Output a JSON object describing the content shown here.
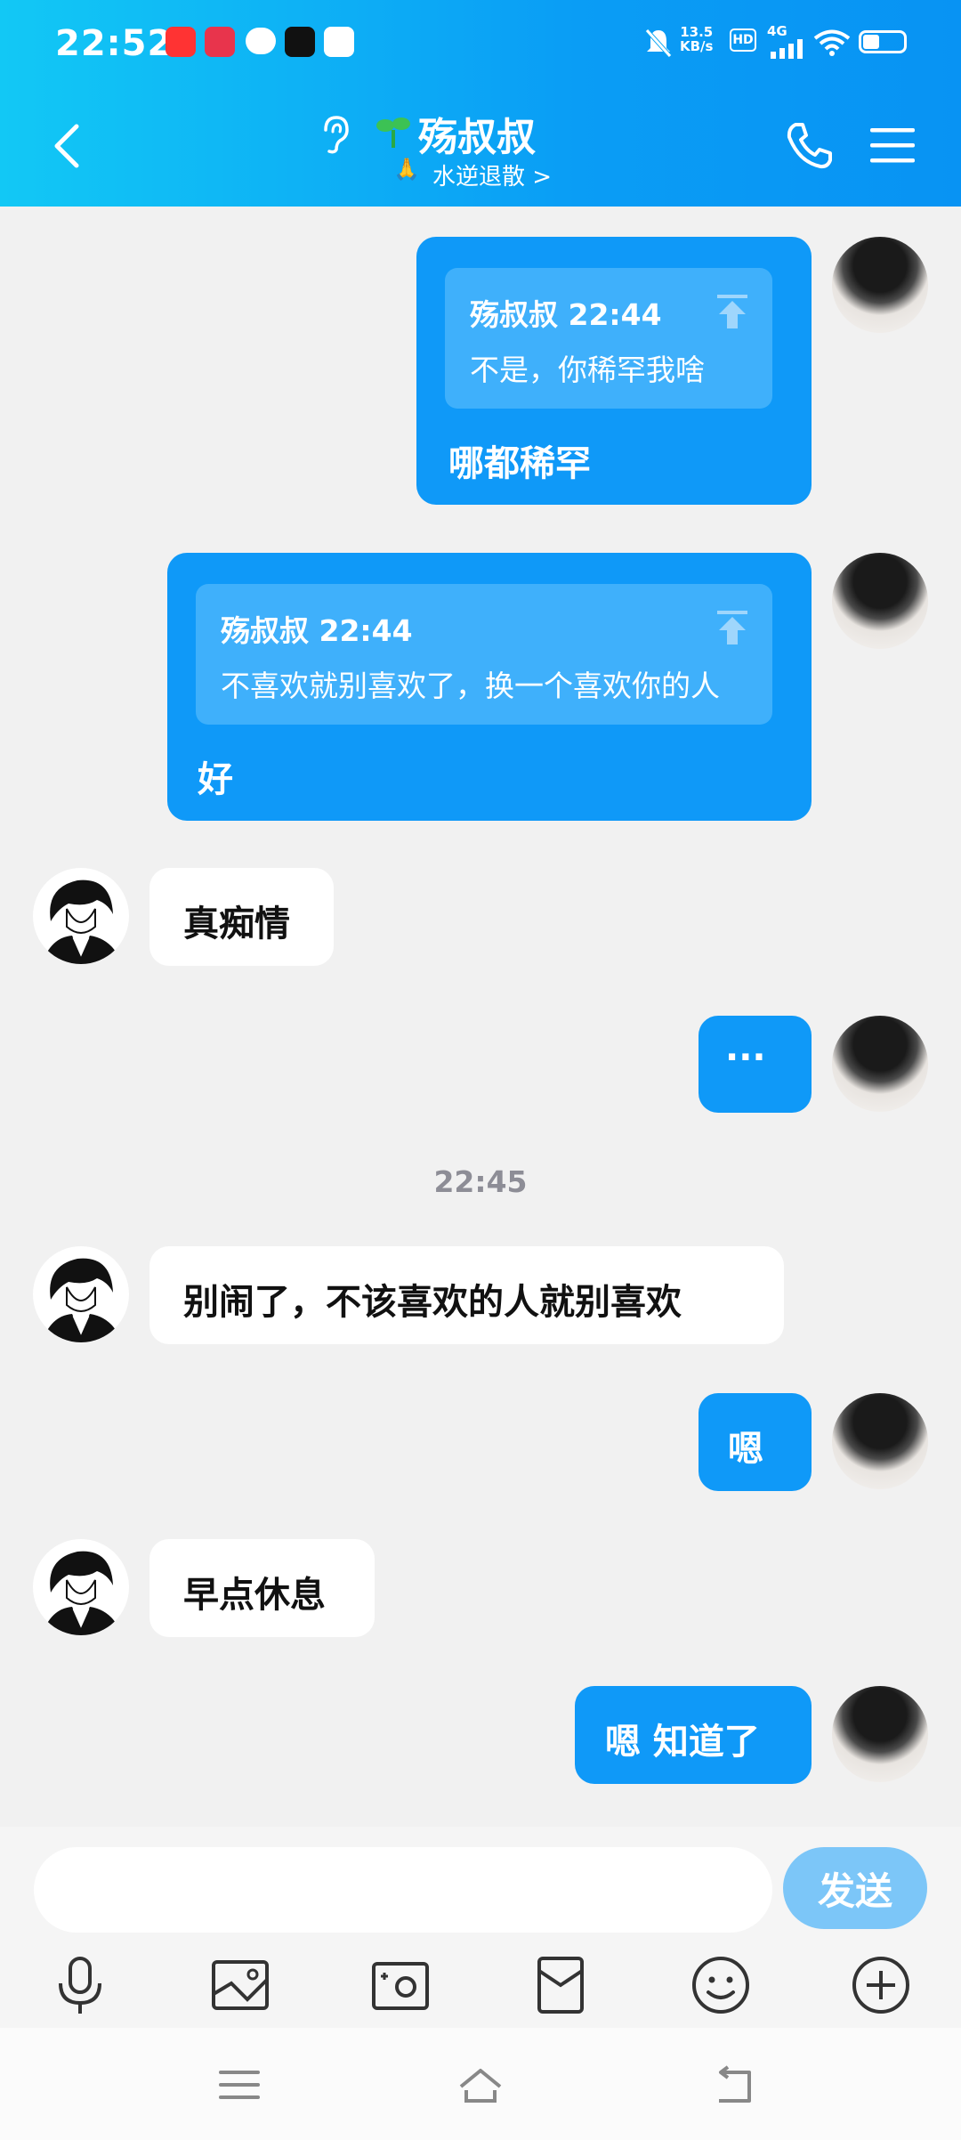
{
  "status_bar": {
    "time": "22:52",
    "speed_value": "13.5",
    "speed_unit": "KB/s",
    "hd_label": "HD",
    "network_label": "4G"
  },
  "header": {
    "contact_name": "殇叔叔",
    "status_text": "水逆退散 >",
    "back_icon": "chevron-left-icon",
    "phone_icon": "phone-icon",
    "menu_icon": "hamburger-menu-icon"
  },
  "messages": [
    {
      "side": "me",
      "quote": {
        "meta": "殇叔叔 22:44",
        "text": "不是，你稀罕我啥"
      },
      "text": "哪都稀罕"
    },
    {
      "side": "me",
      "quote": {
        "meta": "殇叔叔 22:44",
        "text": "不喜欢就别喜欢了，换一个喜欢你的人"
      },
      "text": "好"
    },
    {
      "side": "other",
      "text": "真痴情"
    },
    {
      "side": "me",
      "text": "···"
    },
    {
      "time_divider": "22:45"
    },
    {
      "side": "other",
      "text": "别闹了，不该喜欢的人就别喜欢"
    },
    {
      "side": "me",
      "text": "嗯"
    },
    {
      "side": "other",
      "text": "早点休息"
    },
    {
      "side": "me",
      "text": "嗯 知道了"
    }
  ],
  "composer": {
    "input_value": "",
    "send_label": "发送",
    "tools": [
      "microphone-icon",
      "image-icon",
      "camera-icon",
      "red-packet-icon",
      "emoji-icon",
      "plus-icon"
    ]
  },
  "navigation": [
    "menu-icon",
    "home-icon",
    "back-icon"
  ],
  "colors": {
    "header_start": "#12c8f5",
    "header_end": "#0893f3",
    "my_bubble": "#0f99f8",
    "quote_block": "#3fb0fb",
    "send_button": "#7cc6f8",
    "background": "#f1f1f1"
  }
}
